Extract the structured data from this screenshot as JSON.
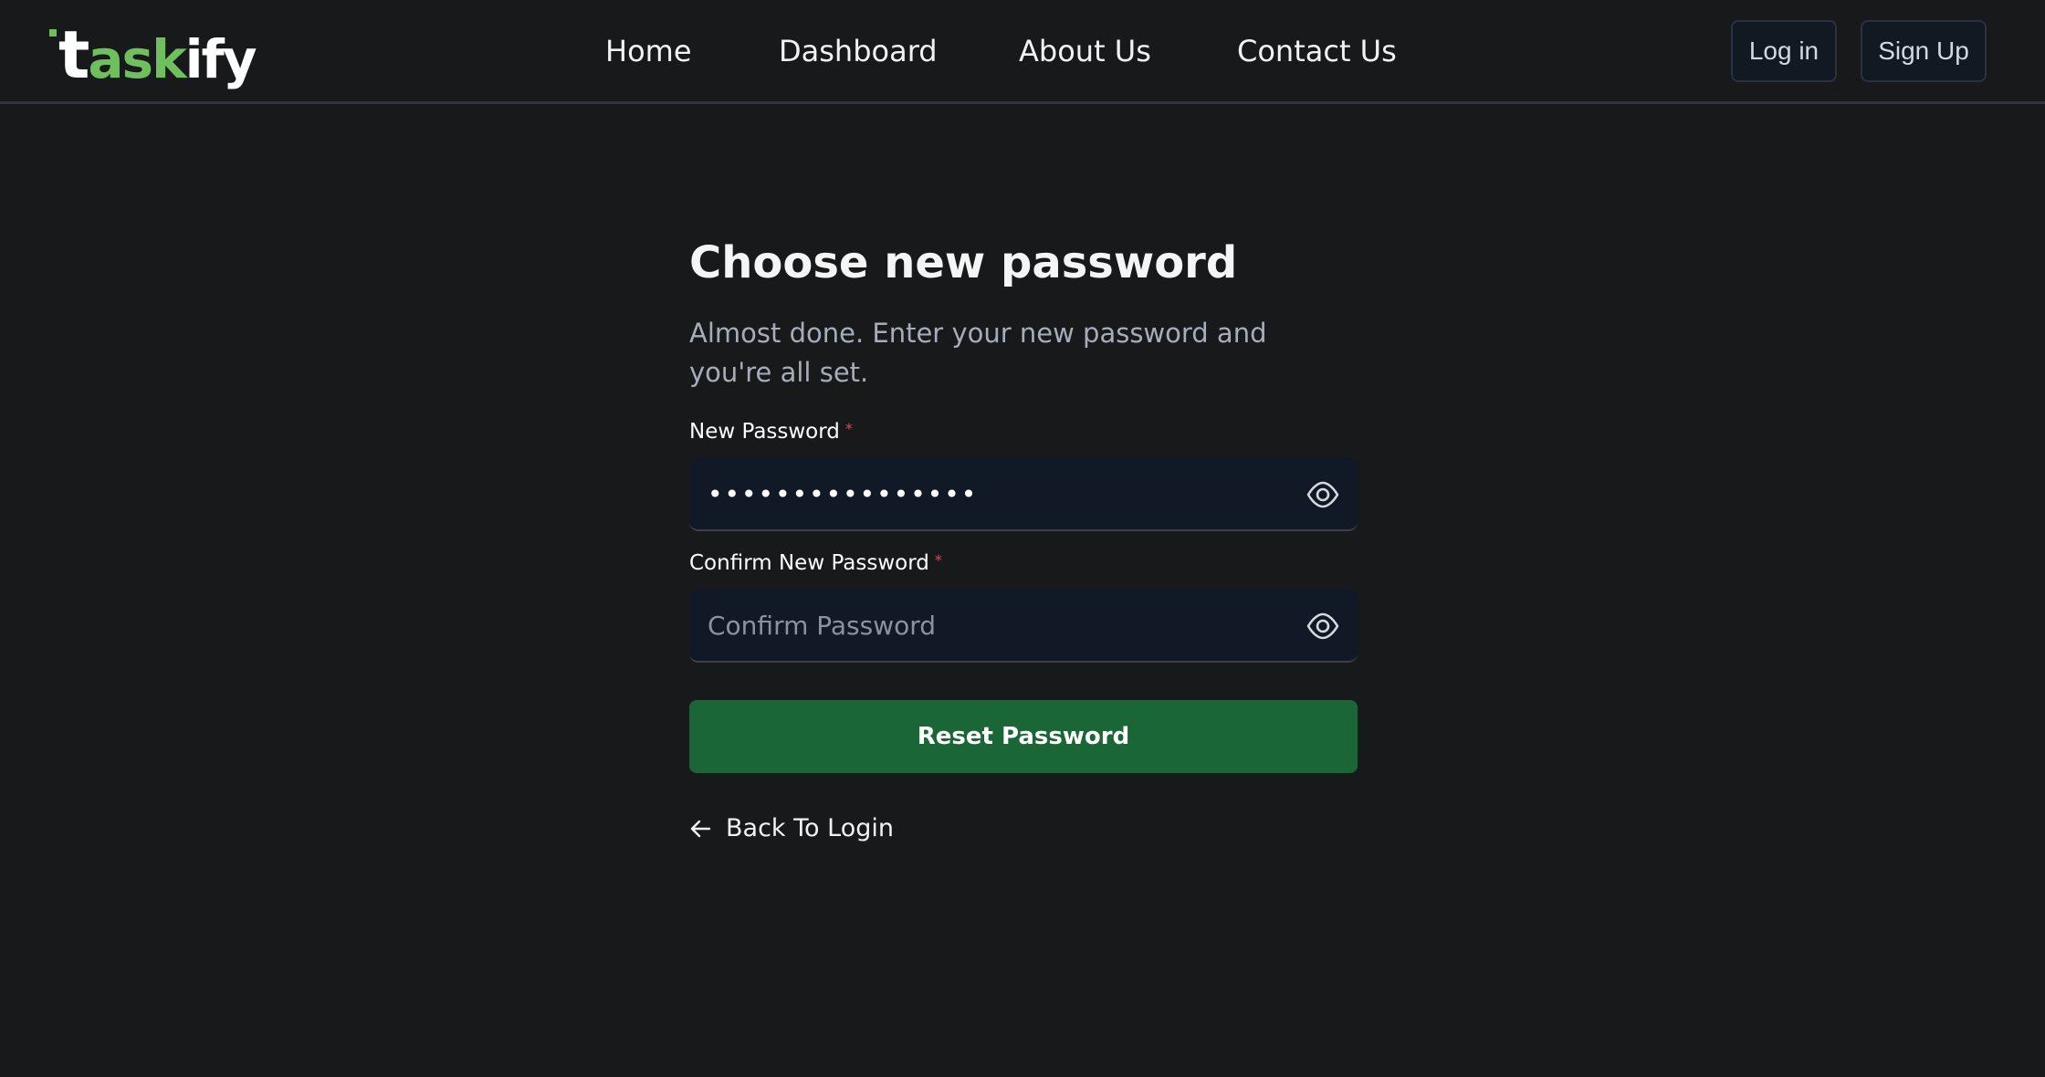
{
  "brand": {
    "logo_text_t": "t",
    "logo_text_ask": "ask",
    "logo_text_ify": "ify",
    "accent_color": "#6fbf5f"
  },
  "nav": {
    "items": [
      {
        "label": "Home"
      },
      {
        "label": "Dashboard"
      },
      {
        "label": "About Us"
      },
      {
        "label": "Contact Us"
      }
    ]
  },
  "auth": {
    "login_label": "Log in",
    "signup_label": "Sign Up"
  },
  "form": {
    "title": "Choose new password",
    "subtitle": "Almost done. Enter your new password and you're all set.",
    "new_password": {
      "label": "New Password",
      "required_mark": "*",
      "value": "••••••••••••••••",
      "icon": "eye-icon"
    },
    "confirm_password": {
      "label": "Confirm New Password",
      "required_mark": "*",
      "value": "",
      "placeholder": "Confirm Password",
      "icon": "eye-icon"
    },
    "submit_label": "Reset Password",
    "submit_color": "#1a6636",
    "back_label": "Back To Login",
    "back_icon": "arrow-left-icon"
  }
}
